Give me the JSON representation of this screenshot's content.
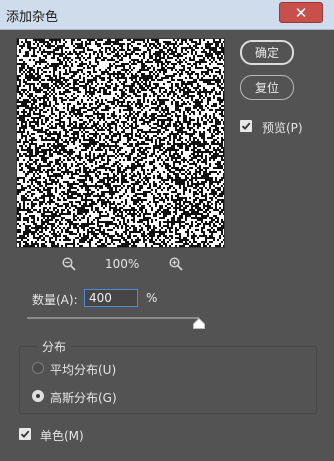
{
  "window": {
    "title": "添加杂色",
    "close_glyph": "✕"
  },
  "buttons": {
    "ok_label": "确定",
    "reset_label": "复位"
  },
  "preview_option": {
    "label": "预览(P)",
    "checked": true
  },
  "zoom": {
    "level": "100%",
    "zoom_out_icon": "zoom-out-icon",
    "zoom_in_icon": "zoom-in-icon"
  },
  "amount": {
    "label": "数量(A):",
    "value": "400",
    "unit": "%",
    "slider_fraction": 1.0
  },
  "distribution": {
    "title": "分布",
    "options": [
      {
        "label": "平均分布(U)",
        "selected": false
      },
      {
        "label": "高斯分布(G)",
        "selected": true
      }
    ]
  },
  "monochromatic": {
    "label": "单色(M)",
    "checked": true
  },
  "colors": {
    "title_bar": "#cfdcec",
    "close_button": "#c7504b",
    "dialog_bg": "#535353",
    "input_focus": "#4f8bd6"
  }
}
